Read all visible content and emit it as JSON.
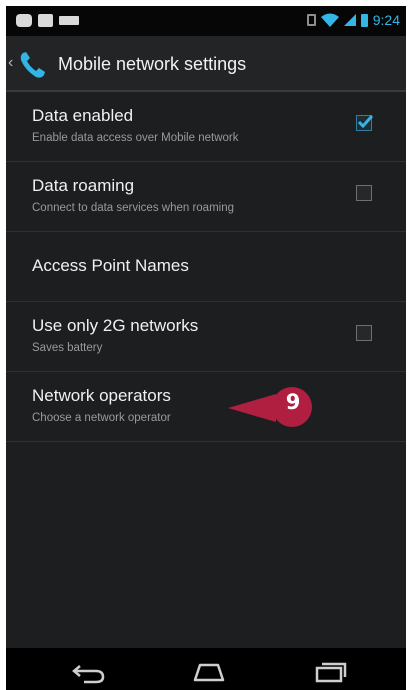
{
  "status_bar": {
    "time": "9:24",
    "icons": [
      "chat-icon",
      "notification-icon",
      "keyboard-icon",
      "vibrate-icon",
      "wifi-icon",
      "signal-icon",
      "battery-icon"
    ],
    "accent_color": "#33b5e5"
  },
  "action_bar": {
    "title": "Mobile network settings",
    "icon": "phone-icon"
  },
  "settings": [
    {
      "title": "Data enabled",
      "summary": "Enable data access over Mobile network",
      "checkbox": true,
      "checked": true
    },
    {
      "title": "Data roaming",
      "summary": "Connect to data services when roaming",
      "checkbox": true,
      "checked": false
    },
    {
      "title": "Access Point Names",
      "summary": "",
      "checkbox": false
    },
    {
      "title": "Use only 2G networks",
      "summary": "Saves battery",
      "checkbox": true,
      "checked": false
    },
    {
      "title": "Network operators",
      "summary": "Choose a network operator",
      "checkbox": false
    }
  ],
  "callout": {
    "label": "9",
    "color": "#b01e40"
  },
  "nav_bar": {
    "buttons": [
      "back-icon",
      "home-icon",
      "recent-apps-icon"
    ]
  }
}
